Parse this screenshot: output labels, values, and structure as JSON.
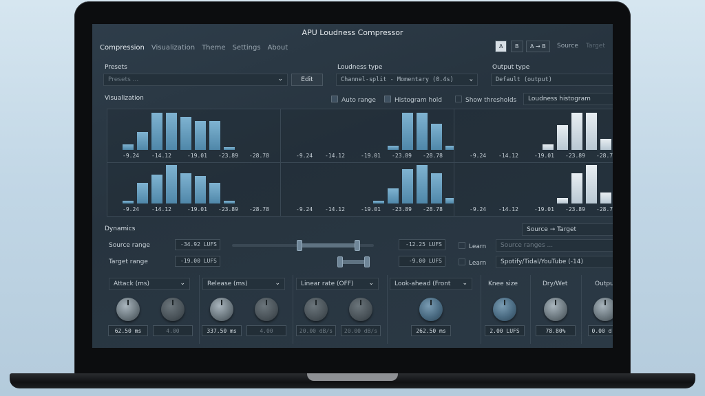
{
  "app": {
    "title": "APU Loudness Compressor"
  },
  "tabs": [
    "Compression",
    "Visualization",
    "Theme",
    "Settings",
    "About"
  ],
  "ab_buttons": [
    "A",
    "B",
    "A → B"
  ],
  "io_labels": [
    "Source",
    "Target"
  ],
  "presets": {
    "label": "Presets",
    "placeholder": "Presets ...",
    "edit_label": "Edit"
  },
  "loudness_type": {
    "label": "Loudness type",
    "value": "Channel-split - Momentary (0.4s)"
  },
  "output_type": {
    "label": "Output type",
    "value": "Default (output)"
  },
  "visualization": {
    "label": "Visualization",
    "auto_range": "Auto range",
    "histogram_hold": "Histogram hold",
    "show_thresholds": "Show thresholds",
    "mode": "Loudness histogram",
    "ticks": [
      "-9.24",
      "-14.12",
      "-19.01",
      "-23.89",
      "-28.78"
    ]
  },
  "dynamics": {
    "label": "Dynamics",
    "mode": "Source → Target",
    "source_range": {
      "label": "Source range",
      "min": "-34.92 LUFS",
      "max": "-12.25 LUFS",
      "learn": "Learn",
      "preset": "Source ranges ..."
    },
    "target_range": {
      "label": "Target range",
      "min": "-19.00 LUFS",
      "max": "-9.00 LUFS",
      "learn": "Learn",
      "preset": "Spotify/Tidal/YouTube (-14)"
    }
  },
  "knobs": {
    "attack": {
      "label": "Attack (ms)",
      "v1": "62.50 ms",
      "v2": "4.00"
    },
    "release": {
      "label": "Release (ms)",
      "v1": "337.50 ms",
      "v2": "4.00"
    },
    "linear": {
      "label": "Linear rate (OFF)",
      "v1": "20.00 dB/s",
      "v2": "20.00 dB/s"
    },
    "lookahead": {
      "label": "Look-ahead (Front",
      "v1": "262.50 ms"
    },
    "knee": {
      "label": "Knee size",
      "v1": "2.00 LUFS"
    },
    "drywet": {
      "label": "Dry/Wet",
      "v1": "78.80%"
    },
    "output": {
      "label": "Outpu",
      "v1": "0.00 d"
    }
  },
  "colors": {
    "accent": "#6fa6c8",
    "panel": "#2b3945",
    "bezel": "#0c0d0f"
  }
}
